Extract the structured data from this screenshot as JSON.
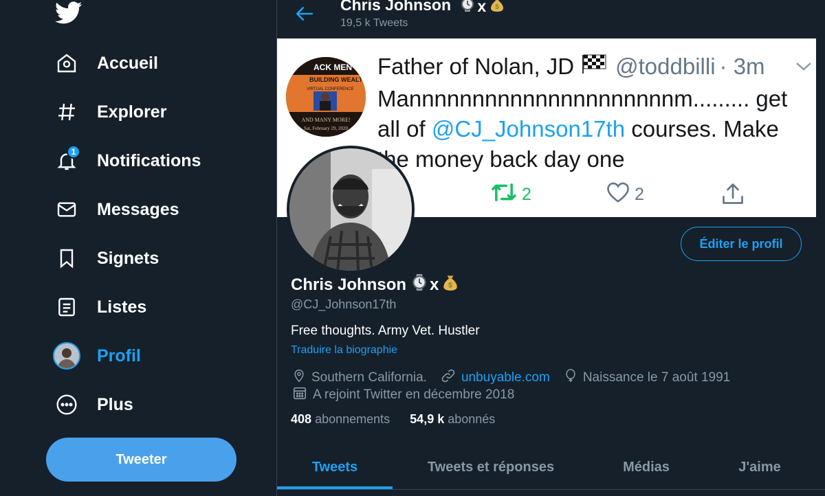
{
  "sidebar": {
    "items": [
      {
        "label": "Accueil",
        "icon": "home-icon"
      },
      {
        "label": "Explorer",
        "icon": "hashtag-icon"
      },
      {
        "label": "Notifications",
        "icon": "bell-icon",
        "badge": "1"
      },
      {
        "label": "Messages",
        "icon": "envelope-icon"
      },
      {
        "label": "Signets",
        "icon": "bookmark-icon"
      },
      {
        "label": "Listes",
        "icon": "list-icon"
      },
      {
        "label": "Profil",
        "icon": "avatar",
        "active": true
      },
      {
        "label": "Plus",
        "icon": "more-icon"
      }
    ],
    "tweet_button": "Tweeter"
  },
  "header": {
    "name": "Chris Johnson",
    "tweet_count": "19,5 k Tweets"
  },
  "banner": {
    "name": "Father of Nolan, JD",
    "handle": "@toddbilli",
    "time": "· 3m",
    "text_before": "Mannnnnnnnnnnnnnnnnnnnnm......... get all of ",
    "mention": "@CJ_Johnson17th",
    "text_after": " courses. Make the money back day one",
    "retweets": "2",
    "likes": "2",
    "avatar_lines": [
      "ACK MEN",
      "BUILDING WEALTH",
      "VIRTUAL CONFERENCE",
      "AND MANY MORE!",
      "Sat, February 29, 2020"
    ]
  },
  "profile": {
    "edit_button": "Éditer le profil",
    "name": "Chris Johnson",
    "emoji_x": "x",
    "handle": "@CJ_Johnson17th",
    "bio": "Free thoughts. Army Vet. Hustler",
    "translate": "Traduire la biographie",
    "location": "Southern California.",
    "website": "unbuyable.com",
    "birthday": "Naissance le 7 août 1991",
    "joined": "A rejoint Twitter en décembre 2018",
    "following_count": "408",
    "following_label": "abonnements",
    "followers_count": "54,9 k",
    "followers_label": "abonnés"
  },
  "tabs": [
    {
      "label": "Tweets",
      "active": true
    },
    {
      "label": "Tweets et réponses"
    },
    {
      "label": "Médias"
    },
    {
      "label": "J'aime"
    }
  ],
  "colors": {
    "background": "#15202b",
    "accent": "#1da1f2",
    "muted": "#8899a6",
    "retweet": "#17bf63"
  }
}
